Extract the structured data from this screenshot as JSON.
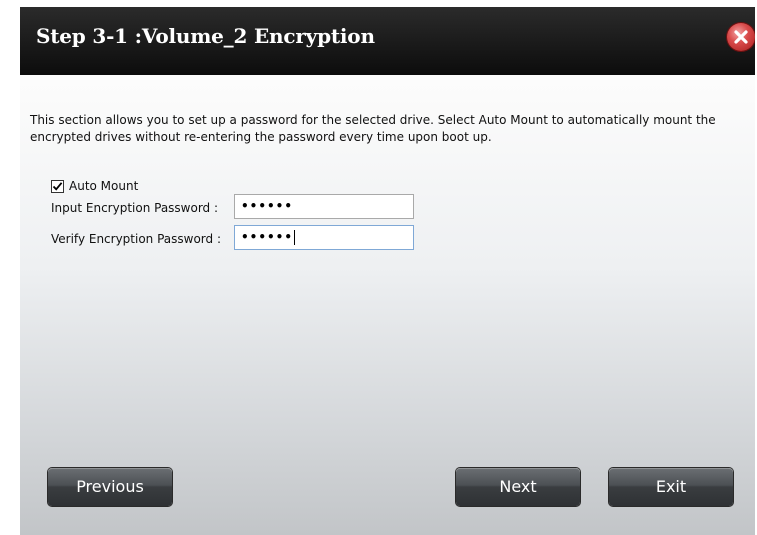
{
  "dialog": {
    "title": "Step 3-1 :Volume_2 Encryption",
    "description": "This section allows you to set up a password for the selected drive. Select Auto Mount to automatically mount the encrypted drives without re-entering the password every time upon boot up.",
    "auto_mount": {
      "label": "Auto Mount",
      "checked": true
    },
    "fields": [
      {
        "label": "Input Encryption Password :",
        "value": "••••••"
      },
      {
        "label": "Verify Encryption Password :",
        "value": "••••••"
      }
    ],
    "buttons": {
      "previous": "Previous",
      "next": "Next",
      "exit": "Exit"
    }
  },
  "icons": {
    "close": "close-x-icon",
    "check": "checkmark-icon"
  },
  "colors": {
    "titlebar": "#111111",
    "close": "#d94b4b",
    "button": "#45494d"
  }
}
